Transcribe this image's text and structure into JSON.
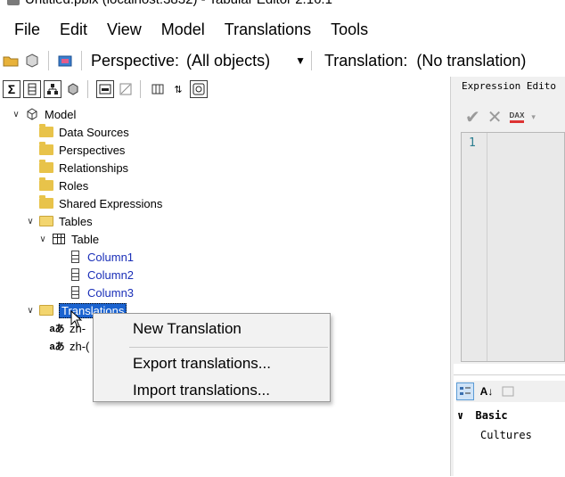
{
  "window": {
    "title": "Untitled.pbix (localhost:3832) - Tabular Editor 2.16.1"
  },
  "menu": [
    "File",
    "Edit",
    "View",
    "Model",
    "Translations",
    "Tools"
  ],
  "toolbar": {
    "perspective_label": "Perspective:",
    "perspective_value": "(All objects)",
    "translation_label": "Translation:",
    "translation_value": "(No translation)"
  },
  "tree": {
    "model": "Model",
    "folders": [
      "Data Sources",
      "Perspectives",
      "Relationships",
      "Roles",
      "Shared Expressions"
    ],
    "tables_folder": "Tables",
    "table": "Table",
    "columns": [
      "Column1",
      "Column2",
      "Column3"
    ],
    "translations_folder": "Translations",
    "cultures": [
      "zh-",
      "zh-("
    ]
  },
  "expression_editor": {
    "title": "Expression Edito",
    "line_number": "1",
    "dax_label": "DAX"
  },
  "properties": {
    "category": "Basic",
    "rows": [
      "Cultures"
    ]
  },
  "context_menu": {
    "items": [
      "New Translation",
      "Export translations...",
      "Import translations..."
    ]
  },
  "colors": {
    "column_text": "#1a2fb8",
    "selection": "#1b63d0",
    "folder": "#e8c34a"
  }
}
